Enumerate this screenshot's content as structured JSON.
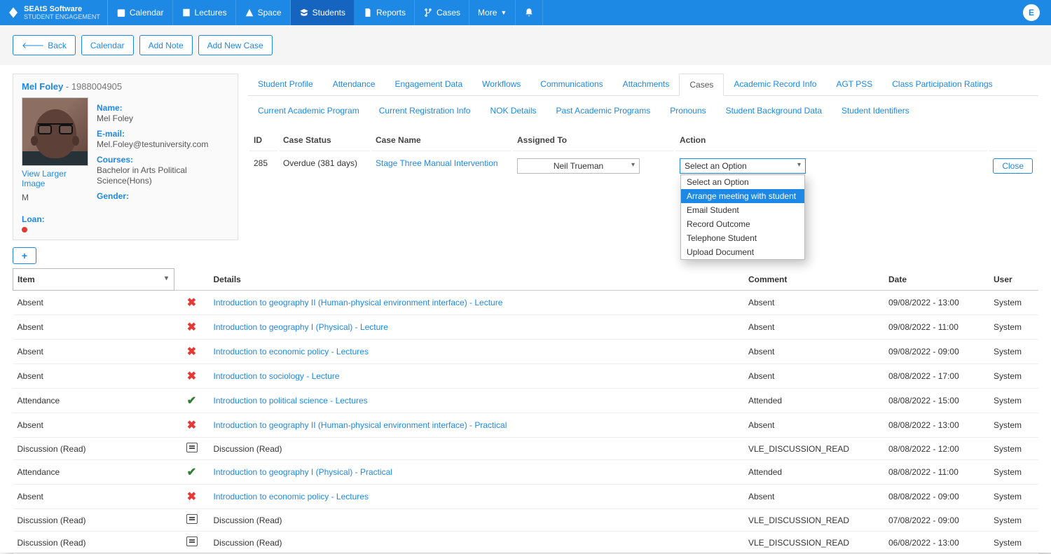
{
  "brand": {
    "name": "SEAtS Software",
    "sub": "STUDENT ENGAGEMENT"
  },
  "nav": {
    "items": [
      {
        "label": "Calendar",
        "icon": "calendar"
      },
      {
        "label": "Lectures",
        "icon": "book"
      },
      {
        "label": "Space",
        "icon": "building"
      },
      {
        "label": "Students",
        "icon": "grad",
        "active": true
      },
      {
        "label": "Reports",
        "icon": "file"
      },
      {
        "label": "Cases",
        "icon": "branch"
      },
      {
        "label": "More",
        "icon": "caret"
      }
    ],
    "bell": "bell",
    "user_initial": "E"
  },
  "toolbar": {
    "back": "Back",
    "calendar": "Calendar",
    "add_note": "Add Note",
    "add_case": "Add New Case"
  },
  "student": {
    "name_link": "Mel Foley",
    "id": "1988004905",
    "labels": {
      "name": "Name:",
      "email": "E-mail:",
      "courses": "Courses:",
      "gender": "Gender:",
      "loan": "Loan:"
    },
    "name": "Mel Foley",
    "email": "Mel.Foley@testuniversity.com",
    "course": "Bachelor in Arts Political Science(Hons)",
    "view_larger": "View Larger Image",
    "gender_value": "M"
  },
  "tabs": {
    "row1": [
      "Student Profile",
      "Attendance",
      "Engagement Data",
      "Workflows",
      "Communications",
      "Attachments",
      "Cases",
      "Academic Record Info",
      "AGT PSS",
      "Class Participation Ratings"
    ],
    "row2": [
      "Current Academic Program",
      "Current Registration Info",
      "NOK Details",
      "Past Academic Programs",
      "Pronouns",
      "Student Background Data",
      "Student Identifiers"
    ],
    "active": "Cases"
  },
  "cases": {
    "headers": {
      "id": "ID",
      "status": "Case Status",
      "name": "Case Name",
      "assigned": "Assigned To",
      "action": "Action"
    },
    "row": {
      "id": "285",
      "status": "Overdue (381 days)",
      "name": "Stage Three Manual Intervention",
      "assigned": "Neil Trueman",
      "action_placeholder": "Select an Option",
      "options": [
        "Select an Option",
        "Arrange meeting with student",
        "Email Student",
        "Record Outcome",
        "Telephone Student",
        "Upload Document"
      ],
      "hover_index": 1,
      "close": "Close"
    }
  },
  "log_headers": {
    "item": "Item",
    "details": "Details",
    "comment": "Comment",
    "date": "Date",
    "user": "User"
  },
  "log": [
    {
      "item": "Absent",
      "icon": "x",
      "details": "Introduction to geography II (Human-physical environment interface) - Lecture",
      "link": true,
      "comment": "Absent",
      "date": "09/08/2022 - 13:00",
      "user": "System"
    },
    {
      "item": "Absent",
      "icon": "x",
      "details": "Introduction to geography I (Physical) - Lecture",
      "link": true,
      "comment": "Absent",
      "date": "09/08/2022 - 11:00",
      "user": "System"
    },
    {
      "item": "Absent",
      "icon": "x",
      "details": "Introduction to economic policy - Lectures",
      "link": true,
      "comment": "Absent",
      "date": "09/08/2022 - 09:00",
      "user": "System"
    },
    {
      "item": "Absent",
      "icon": "x",
      "details": "Introduction to sociology - Lecture",
      "link": true,
      "comment": "Absent",
      "date": "08/08/2022 - 17:00",
      "user": "System"
    },
    {
      "item": "Attendance",
      "icon": "check",
      "details": "Introduction to political science - Lectures",
      "link": true,
      "comment": "Attended",
      "date": "08/08/2022 - 15:00",
      "user": "System"
    },
    {
      "item": "Absent",
      "icon": "x",
      "details": "Introduction to geography II (Human-physical environment interface) - Practical",
      "link": true,
      "comment": "Absent",
      "date": "08/08/2022 - 13:00",
      "user": "System"
    },
    {
      "item": "Discussion (Read)",
      "icon": "disc",
      "details": "Discussion (Read)",
      "link": false,
      "comment": "VLE_DISCUSSION_READ",
      "date": "08/08/2022 - 12:00",
      "user": "System"
    },
    {
      "item": "Attendance",
      "icon": "check",
      "details": "Introduction to geography I (Physical) - Practical",
      "link": true,
      "comment": "Attended",
      "date": "08/08/2022 - 11:00",
      "user": "System"
    },
    {
      "item": "Absent",
      "icon": "x",
      "details": "Introduction to economic policy - Lectures",
      "link": true,
      "comment": "Absent",
      "date": "08/08/2022 - 09:00",
      "user": "System"
    },
    {
      "item": "Discussion (Read)",
      "icon": "disc",
      "details": "Discussion (Read)",
      "link": false,
      "comment": "VLE_DISCUSSION_READ",
      "date": "07/08/2022 - 09:00",
      "user": "System"
    },
    {
      "item": "Discussion (Read)",
      "icon": "disc",
      "details": "Discussion (Read)",
      "link": false,
      "comment": "VLE_DISCUSSION_READ",
      "date": "06/08/2022 - 13:00",
      "user": "System"
    }
  ]
}
